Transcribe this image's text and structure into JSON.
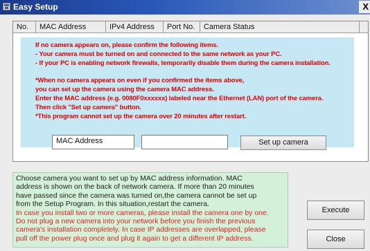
{
  "window": {
    "title": "Easy Setup",
    "close_glyph": "X"
  },
  "camera_list": {
    "columns": [
      "No.",
      "MAC Address",
      "IPv4 Address",
      "Port No.",
      "Camera Status"
    ],
    "rows": []
  },
  "notice": {
    "lines": [
      "If no camera appears on, please confirm the following items.",
      " - Your camera must be turned on and connected to the same network as your PC.",
      " - If your PC is enabling network firewalls, temporarily disable them during the camera installation.",
      "",
      "*When no camera appears on even if you confirmed the items above,",
      " you can set up the camera using the camera MAC address.",
      " Enter the MAC address (e.g. 0080F0xxxxxx) labeled near the Ethernet (LAN) port of the camera.",
      " Then click \"Set up camera\" button.",
      "*This program cannot set up the camera over 20 minutes after restart."
    ]
  },
  "mac_entry": {
    "label": "MAC Address",
    "value": ""
  },
  "buttons": {
    "setup_camera": "Set up camera",
    "execute": "Execute",
    "close": "Close"
  },
  "help": {
    "normal_lines": [
      "Choose camera you want to set up by MAC address information. MAC",
      "address is shown on the back of network camera. If more than 20 minutes",
      "have passed since the camera was turned on,the camera cannot be set up",
      "from the Setup Program. In this situation,restart the camera."
    ],
    "warn_lines": [
      "In case you install two or more cameras, please install the camera one by one.",
      "Do not plug a new camera into your network before you finish the previous",
      "camera's installation completely. In case IP addresses are overlapped, please",
      "pull off the power plug once and plug it again to get a different IP address."
    ]
  },
  "colors": {
    "titlebar": "#2857b8",
    "notice_bg": "#c6e8f5",
    "notice_text": "#e30000",
    "help_bg": "#d3f0d8",
    "help_warn_text": "#e02020"
  }
}
